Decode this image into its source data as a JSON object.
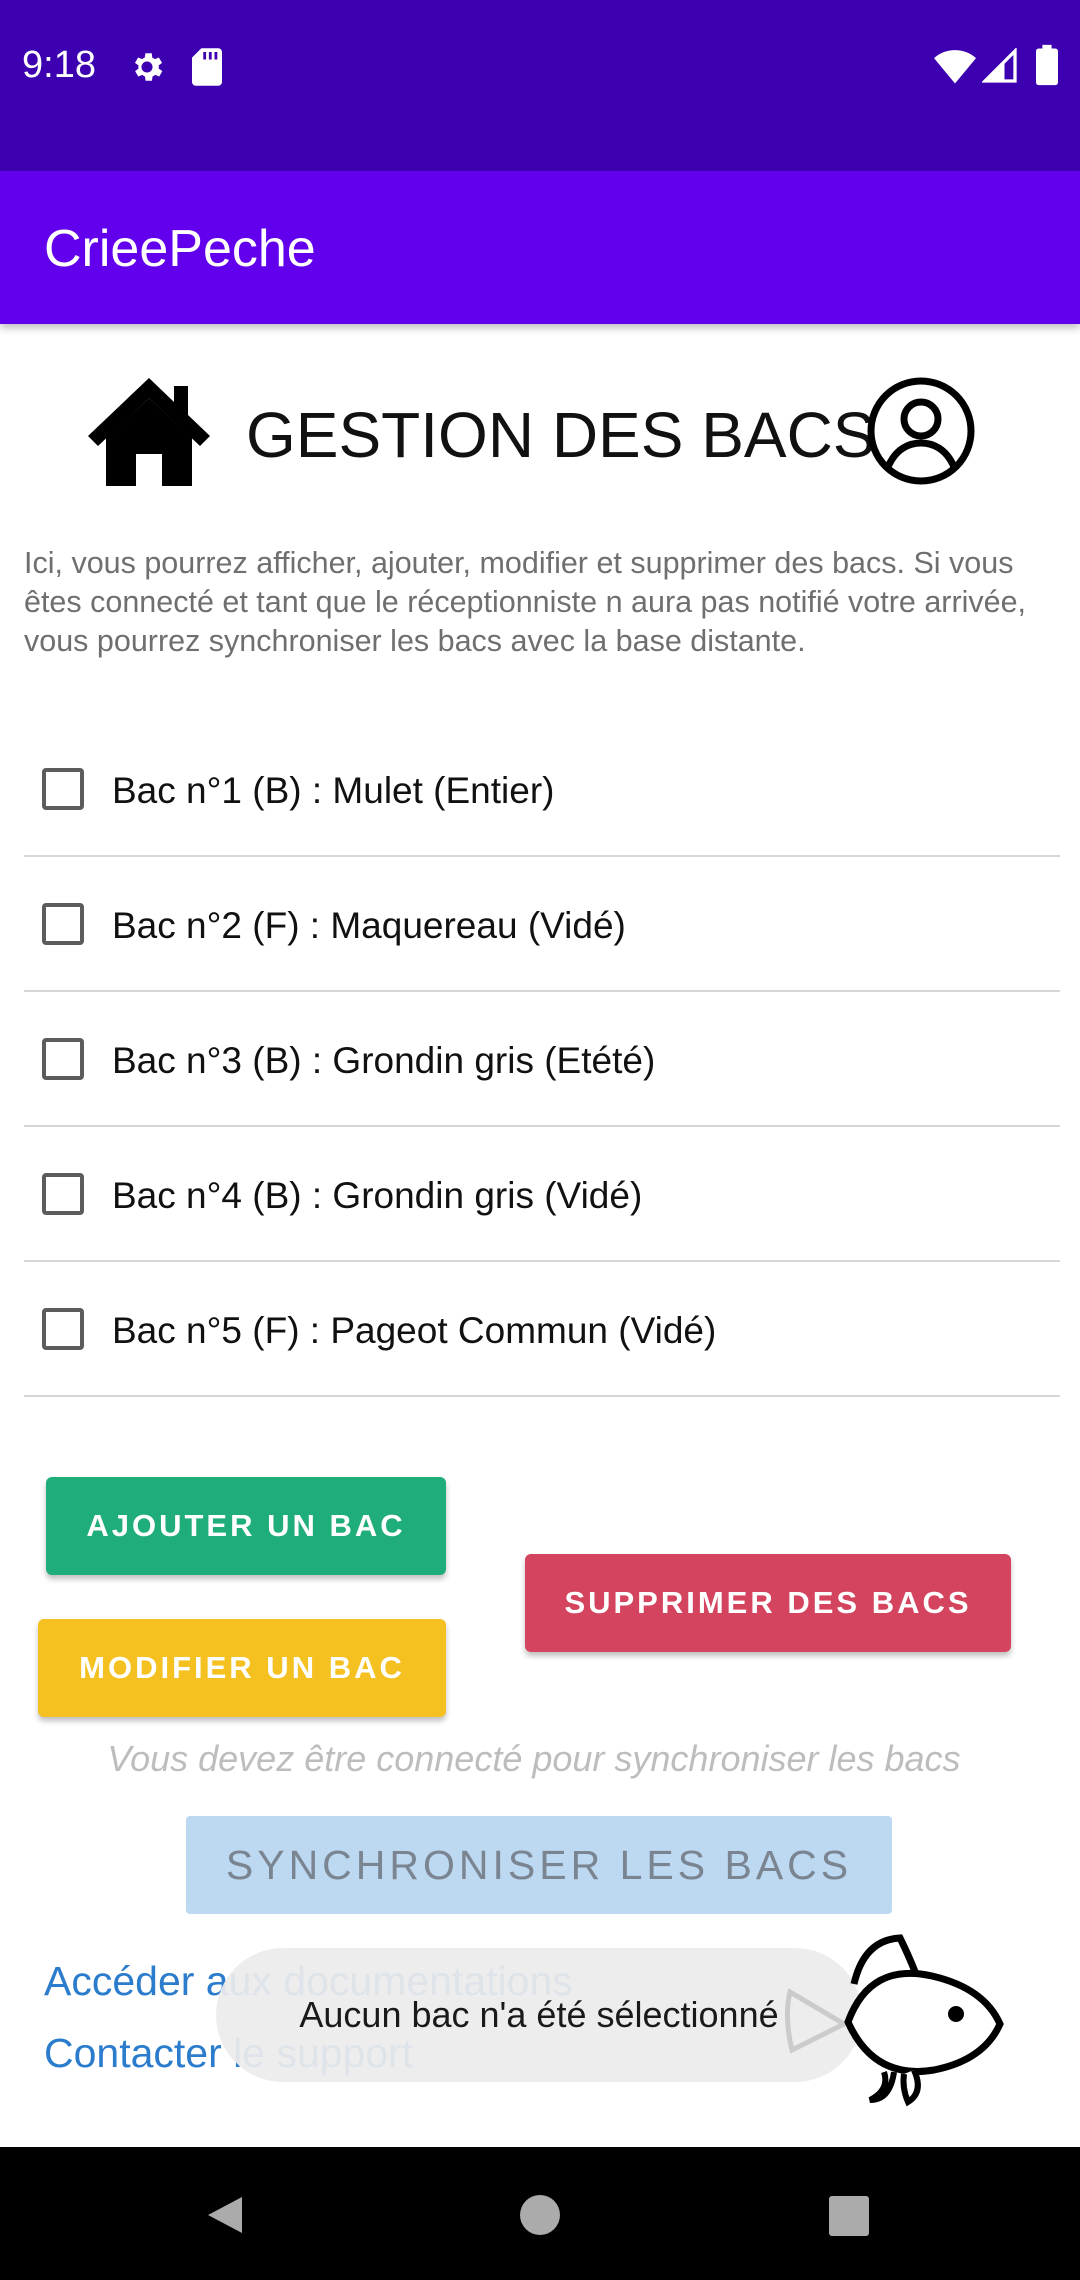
{
  "status_bar": {
    "time": "9:18",
    "icons": [
      "gear-icon",
      "sd-card-icon",
      "wifi-icon",
      "signal-icon",
      "battery-icon"
    ],
    "bg_color": "#3d00b0"
  },
  "app_bar": {
    "title": "CrieePeche",
    "bg_color": "#6200ee"
  },
  "header": {
    "home_icon": "home-icon",
    "title": "GESTION DES BACS",
    "user_icon": "user-circle-icon"
  },
  "intro": "Ici, vous pourrez afficher, ajouter, modifier et supprimer des bacs. Si vous êtes connecté et tant que le réceptionniste n aura pas notifié votre arrivée, vous pourrez synchroniser les bacs avec la base distante.",
  "bacs": [
    {
      "label": "Bac n°1 (B) : Mulet (Entier)",
      "checked": false
    },
    {
      "label": "Bac n°2 (F) : Maquereau (Vidé)",
      "checked": false
    },
    {
      "label": "Bac n°3 (B) : Grondin gris (Etété)",
      "checked": false
    },
    {
      "label": "Bac n°4 (B) : Grondin gris (Vidé)",
      "checked": false
    },
    {
      "label": "Bac n°5 (F) : Pageot Commun (Vidé)",
      "checked": false
    }
  ],
  "buttons": {
    "add": "AJOUTER UN BAC",
    "delete": "SUPPRIMER DES BACS",
    "edit": "MODIFIER UN BAC",
    "sync": "SYNCHRONISER LES BACS",
    "add_color": "#1fae7a",
    "delete_color": "#d4445e",
    "edit_color": "#f4c121",
    "sync_color": "#bdd8f1"
  },
  "sync_hint": "Vous devez être connecté pour synchroniser les bacs",
  "links": {
    "docs": "Accéder aux documentations",
    "support": "Contacter le support"
  },
  "toast": "Aucun bac n'a été sélectionné",
  "decor": {
    "fish_icon": "fish-icon"
  },
  "nav_bar": {
    "icons": [
      "back-icon",
      "home-circle-icon",
      "recent-apps-icon"
    ]
  }
}
